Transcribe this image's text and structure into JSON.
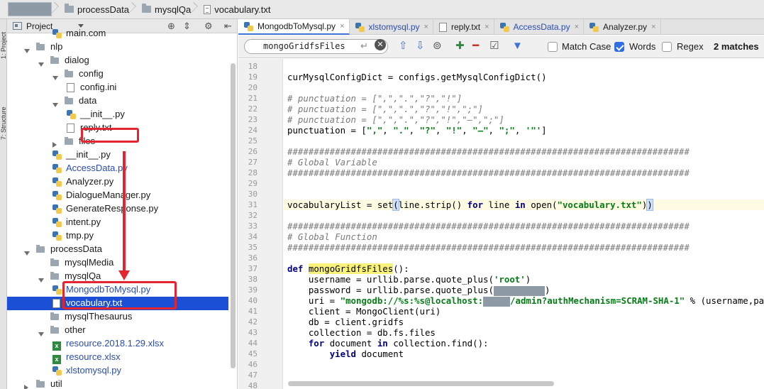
{
  "breadcrumb": {
    "items": [
      "processData",
      "mysqlQa",
      "vocabulary.txt"
    ]
  },
  "toolstrip": {
    "tabs": [
      "1: Project",
      "7: Structure"
    ]
  },
  "project": {
    "title": "Project",
    "tree": [
      {
        "label": "main.com",
        "depth": 3,
        "kind": "py"
      },
      {
        "label": "nlp",
        "depth": 1,
        "kind": "folder",
        "state": "open"
      },
      {
        "label": "dialog",
        "depth": 2,
        "kind": "folder",
        "state": "open"
      },
      {
        "label": "config",
        "depth": 3,
        "kind": "folder",
        "state": "open"
      },
      {
        "label": "config.ini",
        "depth": 4,
        "kind": "txt"
      },
      {
        "label": "data",
        "depth": 3,
        "kind": "folder",
        "state": "open"
      },
      {
        "label": "__init__.py",
        "depth": 4,
        "kind": "py"
      },
      {
        "label": "reply.txt",
        "depth": 4,
        "kind": "txt"
      },
      {
        "label": "files",
        "depth": 3,
        "kind": "folder",
        "state": "closed"
      },
      {
        "label": "__init__.py",
        "depth": 3,
        "kind": "py"
      },
      {
        "label": "AccessData.py",
        "depth": 3,
        "kind": "py",
        "blue": true
      },
      {
        "label": "Analyzer.py",
        "depth": 3,
        "kind": "py"
      },
      {
        "label": "DialogueManager.py",
        "depth": 3,
        "kind": "py"
      },
      {
        "label": "GenerateResponse.py",
        "depth": 3,
        "kind": "py"
      },
      {
        "label": "intent.py",
        "depth": 3,
        "kind": "py"
      },
      {
        "label": "tmp.py",
        "depth": 3,
        "kind": "py"
      },
      {
        "label": "processData",
        "depth": 1,
        "kind": "folder",
        "state": "open"
      },
      {
        "label": "mysqlMedia",
        "depth": 2,
        "kind": "folder",
        "state": "none"
      },
      {
        "label": "mysqlQa",
        "depth": 2,
        "kind": "folder",
        "state": "open"
      },
      {
        "label": "MongodbToMysql.py",
        "depth": 3,
        "kind": "py",
        "blue": true
      },
      {
        "label": "vocabulary.txt",
        "depth": 3,
        "kind": "txt",
        "selected": true
      },
      {
        "label": "mysqlThesaurus",
        "depth": 2,
        "kind": "folder",
        "state": "none"
      },
      {
        "label": "other",
        "depth": 2,
        "kind": "folder",
        "state": "open"
      },
      {
        "label": "resource.2018.1.29.xlsx",
        "depth": 3,
        "kind": "xls",
        "blue": true
      },
      {
        "label": "resource.xlsx",
        "depth": 3,
        "kind": "xls",
        "blue": true
      },
      {
        "label": "xlstomysql.py",
        "depth": 3,
        "kind": "py",
        "blue": true
      },
      {
        "label": "util",
        "depth": 1,
        "kind": "folder",
        "state": "closed"
      }
    ]
  },
  "editor": {
    "tabs": [
      {
        "label": "MongodbToMysql.py",
        "active": true
      },
      {
        "label": "xlstomysql.py",
        "active": false
      },
      {
        "label": "reply.txt",
        "active": false
      },
      {
        "label": "AccessData.py",
        "active": false
      },
      {
        "label": "Analyzer.py",
        "active": false
      }
    ],
    "find": {
      "query": "mongoGridfsFiles",
      "match_case_label": "Match Case",
      "match_case": false,
      "words_label": "Words",
      "words": true,
      "regex_label": "Regex",
      "regex": false,
      "matches": "2 matches"
    },
    "current_line": 31,
    "lines": [
      {
        "n": "18",
        "code": ""
      },
      {
        "n": "19",
        "code": "curMysqlConfigDict = configs.getMysqlConfigDict()"
      },
      {
        "n": "20",
        "code": ""
      },
      {
        "n": "21",
        "code": "# punctuation = [\",\",\".\",\"?\",\"!\"]"
      },
      {
        "n": "22",
        "code": "# punctuation = [\",\",\".\",\"?\",\"!\",\";\"]"
      },
      {
        "n": "23",
        "code": "# punctuation = [\",\",\".\",\"?\",\"!\",\"—\",\";\"]"
      },
      {
        "n": "24",
        "code": "punctuation = [\",\", \".\", \"?\", \"!\", \"—\", \";\", '\"']"
      },
      {
        "n": "25",
        "code": ""
      },
      {
        "n": "26",
        "code": "############################################################################"
      },
      {
        "n": "27",
        "code": "# Global Variable"
      },
      {
        "n": "28",
        "code": "############################################################################"
      },
      {
        "n": "29",
        "code": ""
      },
      {
        "n": "30",
        "code": ""
      },
      {
        "n": "31",
        "code": "vocabularyList = set(line.strip() for line in open(\"vocabulary.txt\"))"
      },
      {
        "n": "32",
        "code": ""
      },
      {
        "n": "33",
        "code": "############################################################################"
      },
      {
        "n": "34",
        "code": "# Global Function"
      },
      {
        "n": "35",
        "code": "############################################################################"
      },
      {
        "n": "36",
        "code": ""
      },
      {
        "n": "37",
        "code": "def mongoGridfsFiles():"
      },
      {
        "n": "38",
        "code": "    username = urllib.parse.quote_plus('root')"
      },
      {
        "n": "39",
        "code": "    password = urllib.parse.quote_plus(          )"
      },
      {
        "n": "40",
        "code": "    uri = \"mongodb://%s:%s@localhost:     /admin?authMechanism=SCRAM-SHA-1\" % (username,password"
      },
      {
        "n": "41",
        "code": "    client = MongoClient(uri)"
      },
      {
        "n": "42",
        "code": "    db = client.gridfs"
      },
      {
        "n": "43",
        "code": "    collection = db.fs.files"
      },
      {
        "n": "44",
        "code": "    for document in collection.find():"
      },
      {
        "n": "45",
        "code": "        yield document"
      },
      {
        "n": "46",
        "code": ""
      },
      {
        "n": "47",
        "code": ""
      },
      {
        "n": "48",
        "code": ""
      }
    ]
  }
}
